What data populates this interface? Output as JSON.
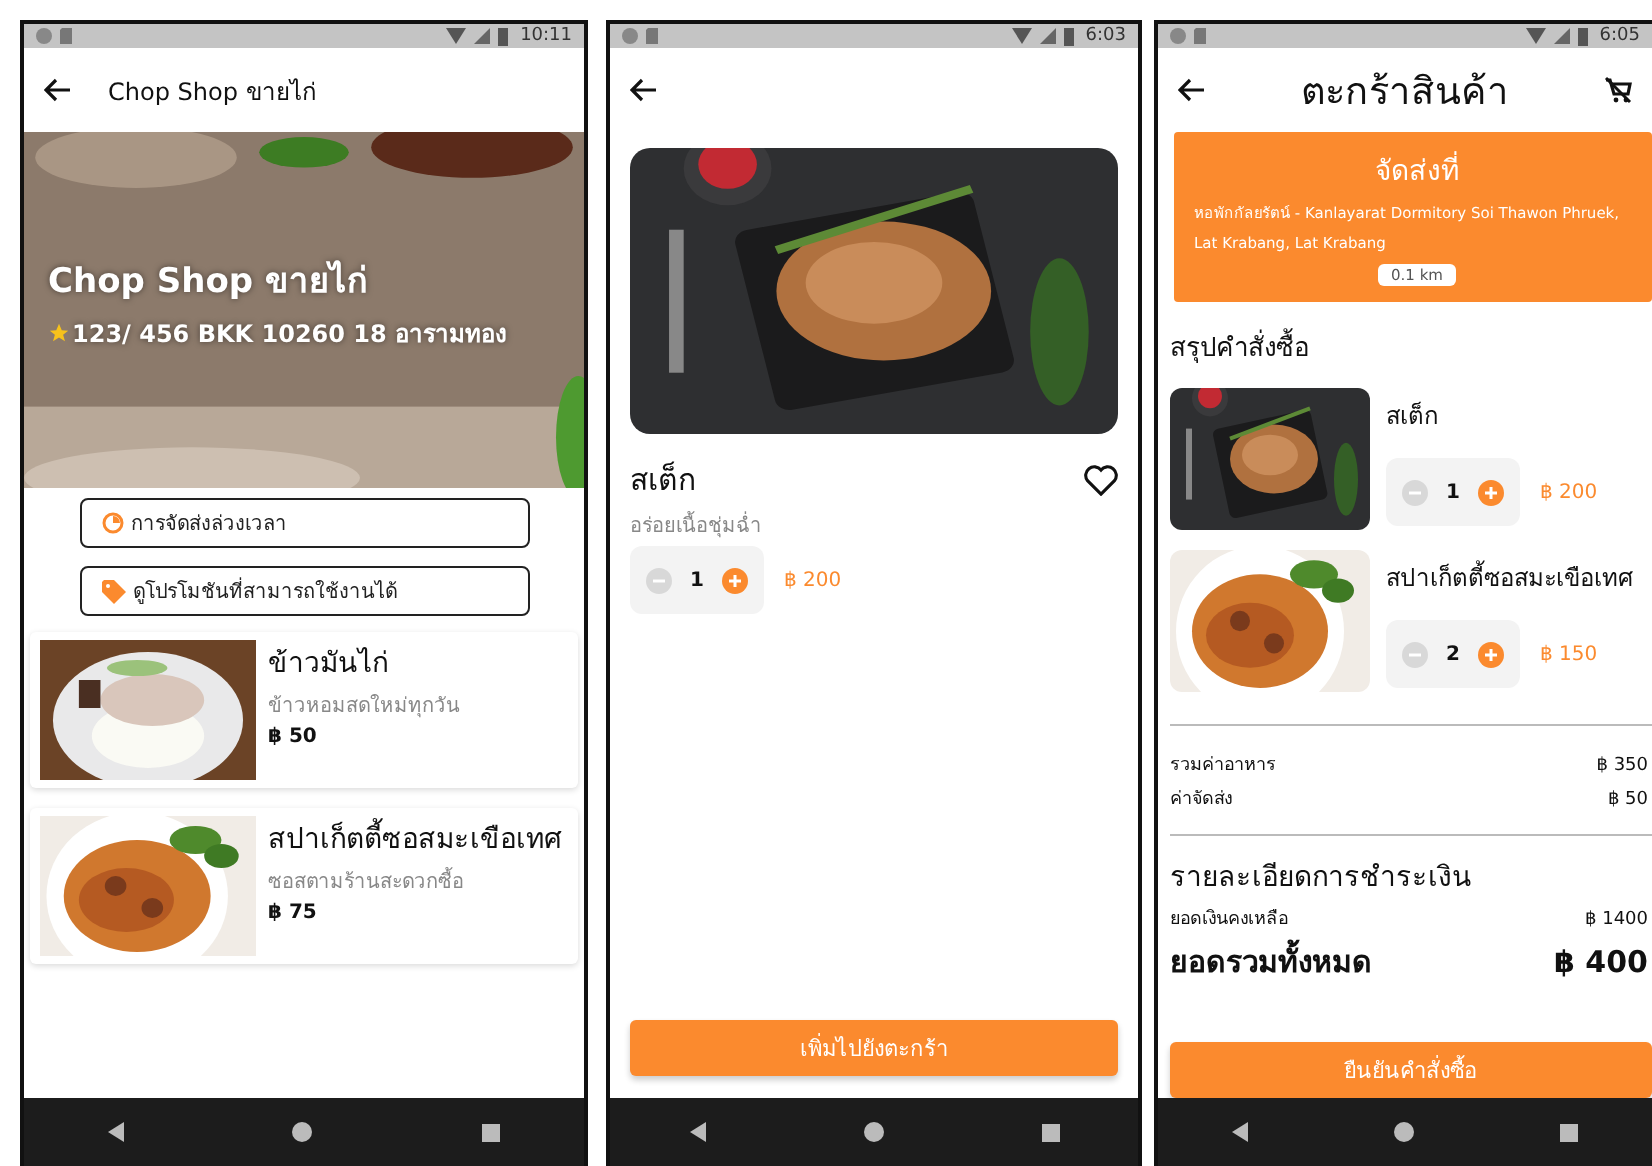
{
  "phones": [
    {
      "kind": "shop",
      "status_time": "10:11",
      "title": "Chop Shop ขายไก่",
      "hero": {
        "name": "Chop Shop ขายไก่",
        "address": "123/ 456 BKK 10260 18 อารามทอง"
      },
      "actions": [
        {
          "kind": "clock",
          "label": "การจัดส่งล่วงเวลา"
        },
        {
          "kind": "tag",
          "label": "ดูโปรโมชันที่สามารถใช้งานได้"
        }
      ],
      "menu": [
        {
          "kind": "chicken",
          "name": "ข้าวมันไก่",
          "description": "ข้าวหอมสดใหม่ทุกวัน",
          "price": "฿ 50"
        },
        {
          "kind": "pasta",
          "name": "สปาเก็ตตี้ซอสมะเขือเทศ",
          "description": "ซอสตามร้านสะดวกซื้อ",
          "price": "฿ 75"
        }
      ]
    },
    {
      "kind": "product",
      "status_time": "6:03",
      "name": "สเต็ก",
      "description": "อร่อยเนื้อชุ่มฉ่ำ",
      "favorite": false,
      "quantity": "1",
      "price": "฿ 200",
      "button": "เพิ่มไปยังตะกร้า"
    },
    {
      "kind": "cart",
      "status_time": "6:05",
      "title": "ตะกร้าสินค้า",
      "delivery": {
        "heading": "จัดส่งที่",
        "address": "หอพักกัลยรัตน์ - Kanlayarat Dormitory Soi Thawon Phruek, Lat Krabang, Lat Krabang",
        "distance": "0.1 km"
      },
      "summary_heading": "สรุปคำสั่งซื้อ",
      "items": [
        {
          "kind": "steak",
          "name": "สเต็ก",
          "quantity": "1",
          "price": "฿ 200"
        },
        {
          "kind": "pasta",
          "name": "สปาเก็ตตี้ซอสมะเขือเทศ",
          "quantity": "2",
          "price": "฿ 150"
        }
      ],
      "costs": [
        {
          "label": "รวมค่าอาหาร",
          "value": "฿ 350"
        },
        {
          "label": "ค่าจัดส่ง",
          "value": "฿ 50"
        }
      ],
      "payment_heading": "รายละเอียดการชำระเงิน",
      "payment": [
        {
          "label": "ยอดเงินคงเหลือ",
          "value": "฿ 1400",
          "emphasis": false
        },
        {
          "label": "ยอดรวมทั้งหมด",
          "value": "฿ 400",
          "emphasis": true
        }
      ],
      "button": "ยืนยันคำสั่งซื้อ"
    }
  ]
}
